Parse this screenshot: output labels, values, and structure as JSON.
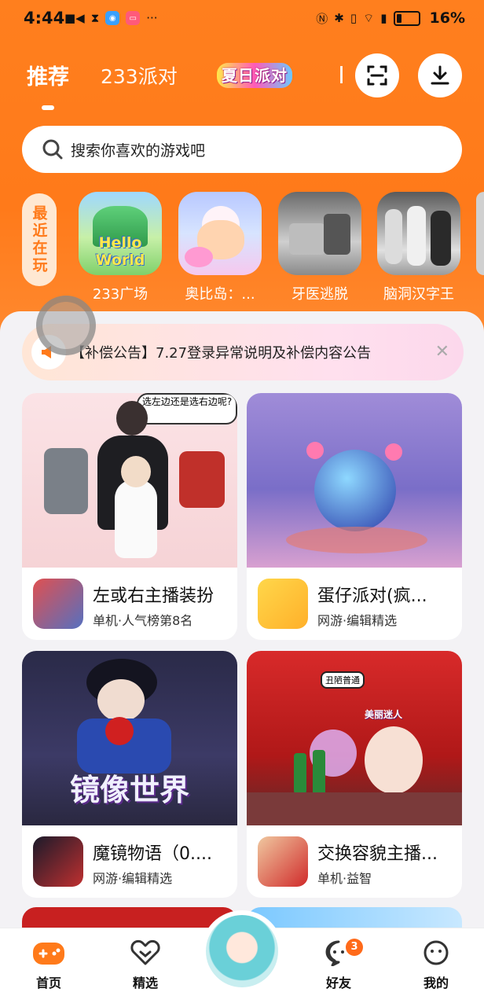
{
  "status_bar": {
    "time": "4:44",
    "dots": "···",
    "battery": "16%"
  },
  "header": {
    "tabs": [
      "推荐",
      "233派对"
    ],
    "event_logo": "夏日派对"
  },
  "search": {
    "placeholder": "搜索你喜欢的游戏吧"
  },
  "recent": {
    "label": "最近在玩",
    "items": [
      {
        "name": "233广场",
        "art_text": "Hello World"
      },
      {
        "name": "奥比岛：..."
      },
      {
        "name": "牙医逃脱"
      },
      {
        "name": "脑洞汉字王"
      }
    ]
  },
  "notice": {
    "text": "【补偿公告】7.27登录异常说明及补偿内容公告"
  },
  "games": [
    {
      "title": "左或右主播装扮",
      "subtitle": "单机·人气榜第8名",
      "speech": "选左边还是选右边呢?"
    },
    {
      "title": "蛋仔派对(疯...",
      "subtitle": "网游·编辑精选"
    },
    {
      "title": "魔镜物语（0....",
      "subtitle": "网游·编辑精选",
      "art_text": "镜像世界"
    },
    {
      "title": "交换容貌主播...",
      "subtitle": "单机·益智",
      "tags": [
        "丑陋普通",
        "美丽迷人"
      ]
    }
  ],
  "bottom_nav": {
    "items": [
      "首页",
      "精选",
      "好友",
      "我的"
    ],
    "friends_badge": "3"
  },
  "colors": {
    "brand": "#ff7a1a",
    "accent": "#ff6a1a"
  }
}
